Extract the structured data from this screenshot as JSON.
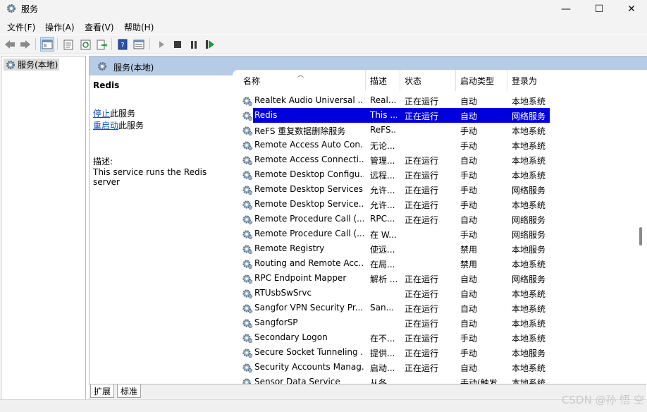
{
  "window": {
    "title": "服务",
    "controls": [
      "—",
      "☐",
      "✕"
    ]
  },
  "menu": [
    "文件(F)",
    "操作(A)",
    "查看(V)",
    "帮助(H)"
  ],
  "tree": {
    "root": "服务(本地)"
  },
  "pane": {
    "header": "服务(本地)"
  },
  "details": {
    "name": "Redis",
    "stop_link": "停止",
    "stop_suffix": "此服务",
    "restart_link": "重启动",
    "restart_suffix": "此服务",
    "desc_label": "描述:",
    "desc_text": "This service runs the Redis server"
  },
  "columns": [
    "名称",
    "描述",
    "状态",
    "启动类型",
    "登录为"
  ],
  "rows": [
    {
      "name": "Realtek Audio Universal ...",
      "desc": "Real...",
      "status": "正在运行",
      "start": "自动",
      "logon": "本地系统"
    },
    {
      "name": "Redis",
      "desc": "This ...",
      "status": "正在运行",
      "start": "自动",
      "logon": "网络服务",
      "selected": true
    },
    {
      "name": "ReFS 重复数据删除服务",
      "desc": "ReFS...",
      "status": "",
      "start": "手动",
      "logon": "本地系统"
    },
    {
      "name": "Remote Access Auto Con...",
      "desc": "无论...",
      "status": "",
      "start": "手动",
      "logon": "本地系统"
    },
    {
      "name": "Remote Access Connecti...",
      "desc": "管理...",
      "status": "正在运行",
      "start": "自动",
      "logon": "本地系统"
    },
    {
      "name": "Remote Desktop Configu...",
      "desc": "远程...",
      "status": "正在运行",
      "start": "手动",
      "logon": "本地系统"
    },
    {
      "name": "Remote Desktop Services",
      "desc": "允许...",
      "status": "正在运行",
      "start": "手动",
      "logon": "网络服务"
    },
    {
      "name": "Remote Desktop Service...",
      "desc": "允许...",
      "status": "正在运行",
      "start": "手动",
      "logon": "本地系统"
    },
    {
      "name": "Remote Procedure Call (...",
      "desc": "RPC...",
      "status": "正在运行",
      "start": "自动",
      "logon": "网络服务"
    },
    {
      "name": "Remote Procedure Call (...",
      "desc": "在 W...",
      "status": "",
      "start": "手动",
      "logon": "网络服务"
    },
    {
      "name": "Remote Registry",
      "desc": "使远...",
      "status": "",
      "start": "禁用",
      "logon": "本地服务"
    },
    {
      "name": "Routing and Remote Acc...",
      "desc": "在局...",
      "status": "",
      "start": "禁用",
      "logon": "本地系统"
    },
    {
      "name": "RPC Endpoint Mapper",
      "desc": "解析 ...",
      "status": "正在运行",
      "start": "自动",
      "logon": "网络服务"
    },
    {
      "name": "RTUsbSwSrvc",
      "desc": "",
      "status": "正在运行",
      "start": "自动",
      "logon": "本地系统"
    },
    {
      "name": "Sangfor VPN Security Pr...",
      "desc": "San...",
      "status": "正在运行",
      "start": "自动",
      "logon": "本地系统"
    },
    {
      "name": "SangforSP",
      "desc": "",
      "status": "正在运行",
      "start": "自动",
      "logon": "本地系统"
    },
    {
      "name": "Secondary Logon",
      "desc": "在不...",
      "status": "正在运行",
      "start": "手动",
      "logon": "本地系统"
    },
    {
      "name": "Secure Socket Tunneling ...",
      "desc": "提供...",
      "status": "正在运行",
      "start": "手动",
      "logon": "本地服务"
    },
    {
      "name": "Security Accounts Manag...",
      "desc": "启动...",
      "status": "正在运行",
      "start": "自动",
      "logon": "本地系统"
    },
    {
      "name": "Sensor Data Service",
      "desc": "从各...",
      "status": "",
      "start": "手动(触发...",
      "logon": "本地系统"
    }
  ],
  "tabs": [
    "扩展",
    "标准"
  ],
  "watermark": "CSDN @孙 悟 空",
  "colors": {
    "selection": "#0000dd",
    "header": "#b5cbe6",
    "link": "#0a4fb8"
  },
  "icons": [
    "services-gear-icon",
    "back-arrow-icon",
    "forward-arrow-icon",
    "console-tree-icon",
    "properties-icon",
    "refresh-icon",
    "export-icon",
    "help-icon",
    "mmc-view-icon",
    "start-icon",
    "stop-icon",
    "pause-icon",
    "restart-icon"
  ]
}
